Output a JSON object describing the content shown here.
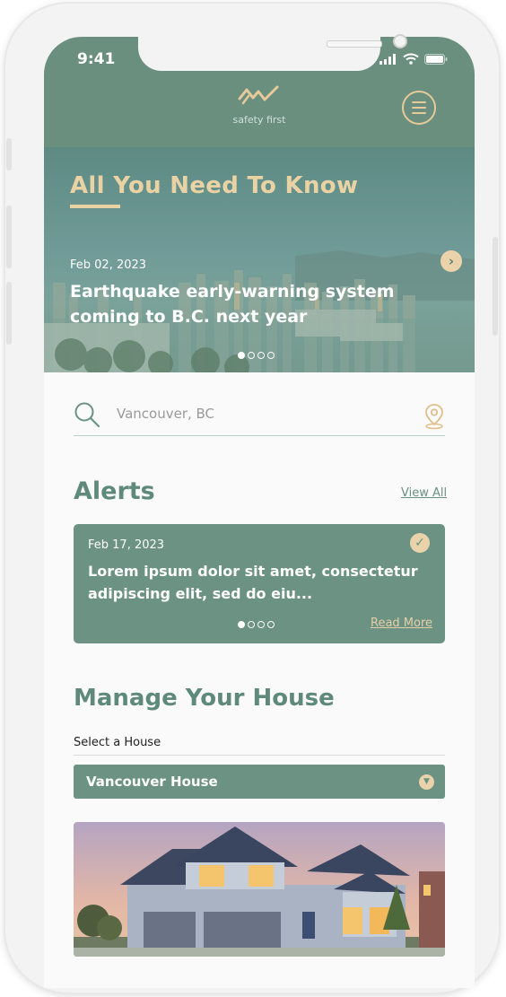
{
  "status_bar": {
    "time": "9:41"
  },
  "header": {
    "logo_text": "safety first"
  },
  "hero": {
    "title": "All You Need To Know",
    "date": "Feb 02, 2023",
    "headline": "Earthquake early-warning system coming to B.C. next year",
    "slide_index": 1,
    "slide_count": 4
  },
  "search": {
    "placeholder": "Vancouver, BC"
  },
  "alerts": {
    "title": "Alerts",
    "view_all": "View All",
    "card": {
      "date": "Feb 17, 2023",
      "text": "Lorem ipsum dolor sit amet, consectetur adipiscing elit, sed do eiu...",
      "read_more": "Read More",
      "slide_index": 1,
      "slide_count": 4
    }
  },
  "manage": {
    "title": "Manage Your House",
    "select_label": "Select a House",
    "selected_house": "Vancouver House"
  },
  "colors": {
    "primary": "#6b9283",
    "accent": "#e9d2a4",
    "background": "#fafafa"
  }
}
